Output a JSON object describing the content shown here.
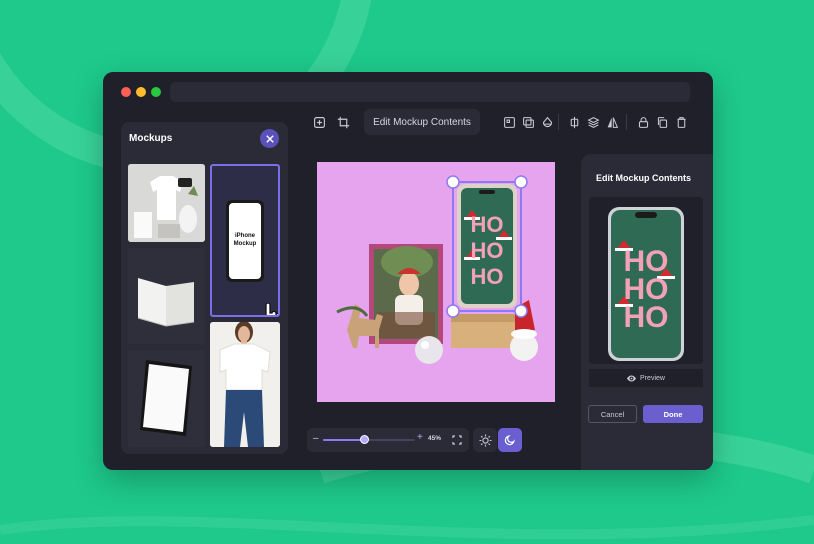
{
  "colors": {
    "background": "#1ec98b",
    "window": "#1f2029",
    "panel": "#2a2b36",
    "accent": "#6b5fd0",
    "traffic_red": "#ff5f57",
    "traffic_yellow": "#febc2e",
    "traffic_green": "#28c840"
  },
  "toolbar": {
    "edit_label": "Edit Mockup Contents",
    "icons": [
      "add-image-icon",
      "crop-icon",
      "align-icon",
      "duplicate-layer-icon",
      "fill-icon",
      "align-center-icon",
      "layers-icon",
      "flip-icon",
      "lock-icon",
      "copy-icon",
      "trash-icon"
    ]
  },
  "mockups_panel": {
    "title": "Mockups",
    "items": [
      {
        "name": "tshirt-flatlay"
      },
      {
        "name": "iphone-mockup",
        "label": "iPhone Mockup",
        "selected": true
      },
      {
        "name": "open-book"
      },
      {
        "name": "woman-tshirt"
      },
      {
        "name": "tablet"
      }
    ]
  },
  "canvas": {
    "phone_text": [
      "HO",
      "HO",
      "HO"
    ]
  },
  "zoom": {
    "minus": "–",
    "plus": "+",
    "percent": "45%",
    "level": 0.45
  },
  "right_panel": {
    "title": "Edit Mockup Contents",
    "preview_label": "Preview",
    "phone_text": [
      "HO",
      "HO",
      "HO"
    ],
    "cancel_label": "Cancel",
    "done_label": "Done"
  }
}
